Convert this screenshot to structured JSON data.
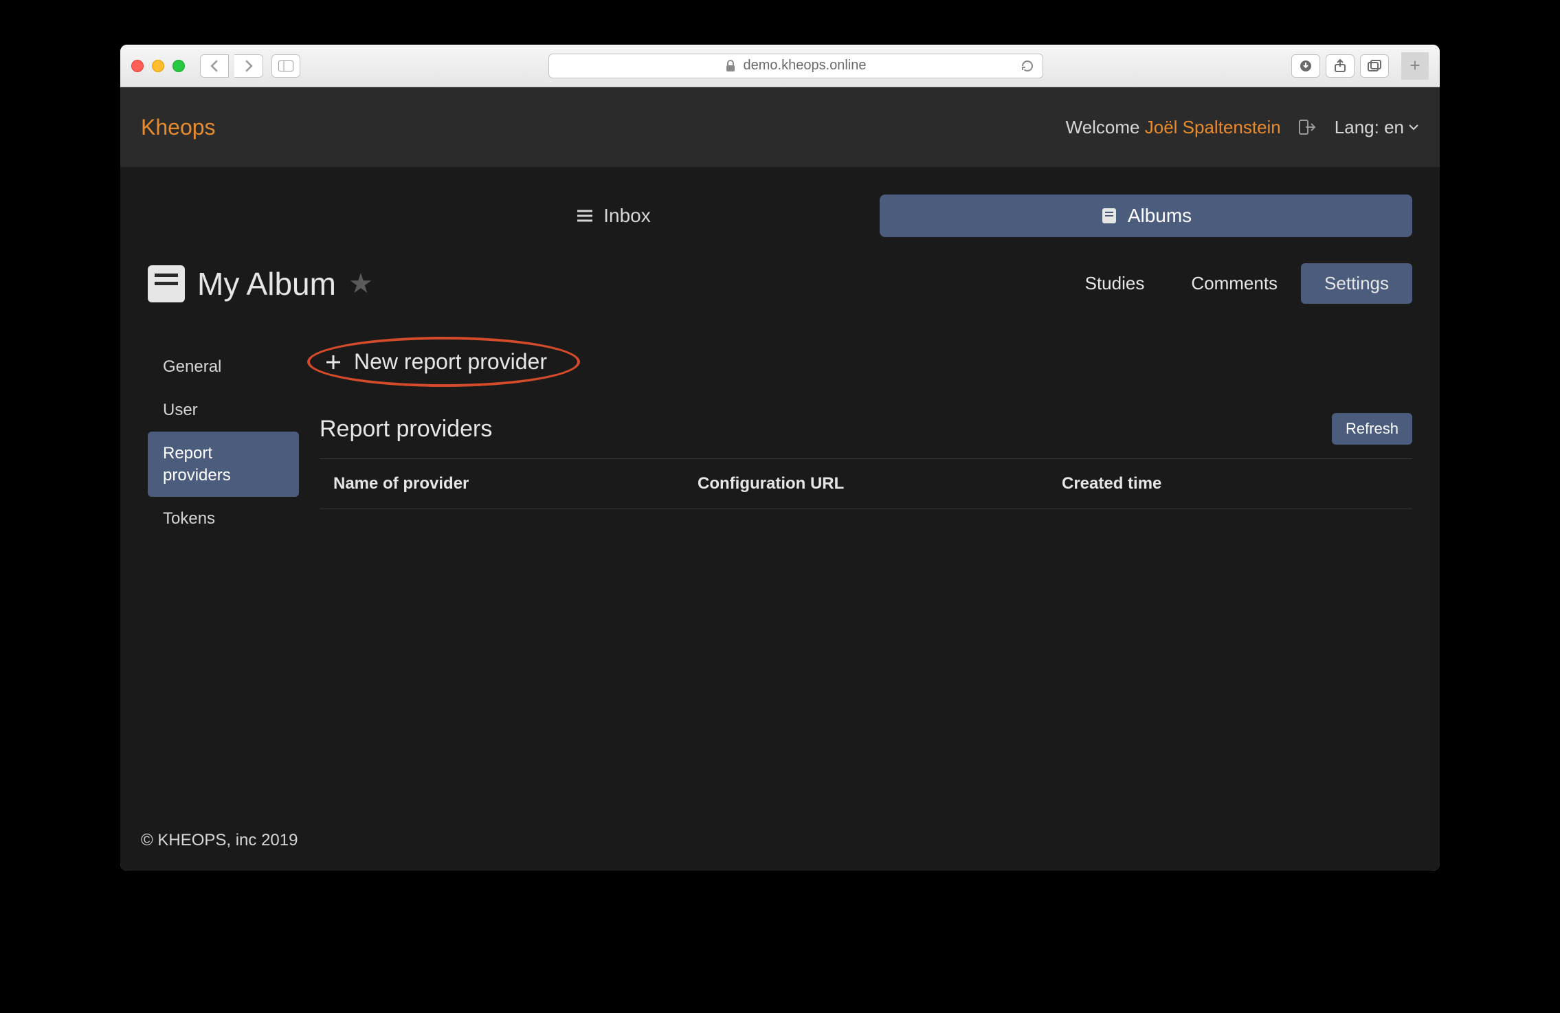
{
  "browser": {
    "url_host": "demo.kheops.online"
  },
  "header": {
    "brand": "Kheops",
    "welcome_prefix": "Welcome",
    "user_name": "Joël Spaltenstein",
    "lang_label": "Lang: en"
  },
  "top_nav": {
    "inbox": "Inbox",
    "albums": "Albums"
  },
  "album": {
    "title": "My Album"
  },
  "album_tabs": {
    "studies": "Studies",
    "comments": "Comments",
    "settings": "Settings"
  },
  "sidebar": {
    "general": "General",
    "user": "User",
    "report_providers": "Report providers",
    "tokens": "Tokens"
  },
  "main": {
    "new_report_provider": "New report provider",
    "section_title": "Report providers",
    "refresh": "Refresh",
    "columns": {
      "name": "Name of provider",
      "config_url": "Configuration URL",
      "created": "Created time"
    }
  },
  "footer": {
    "copyright": "© KHEOPS, inc 2019"
  }
}
